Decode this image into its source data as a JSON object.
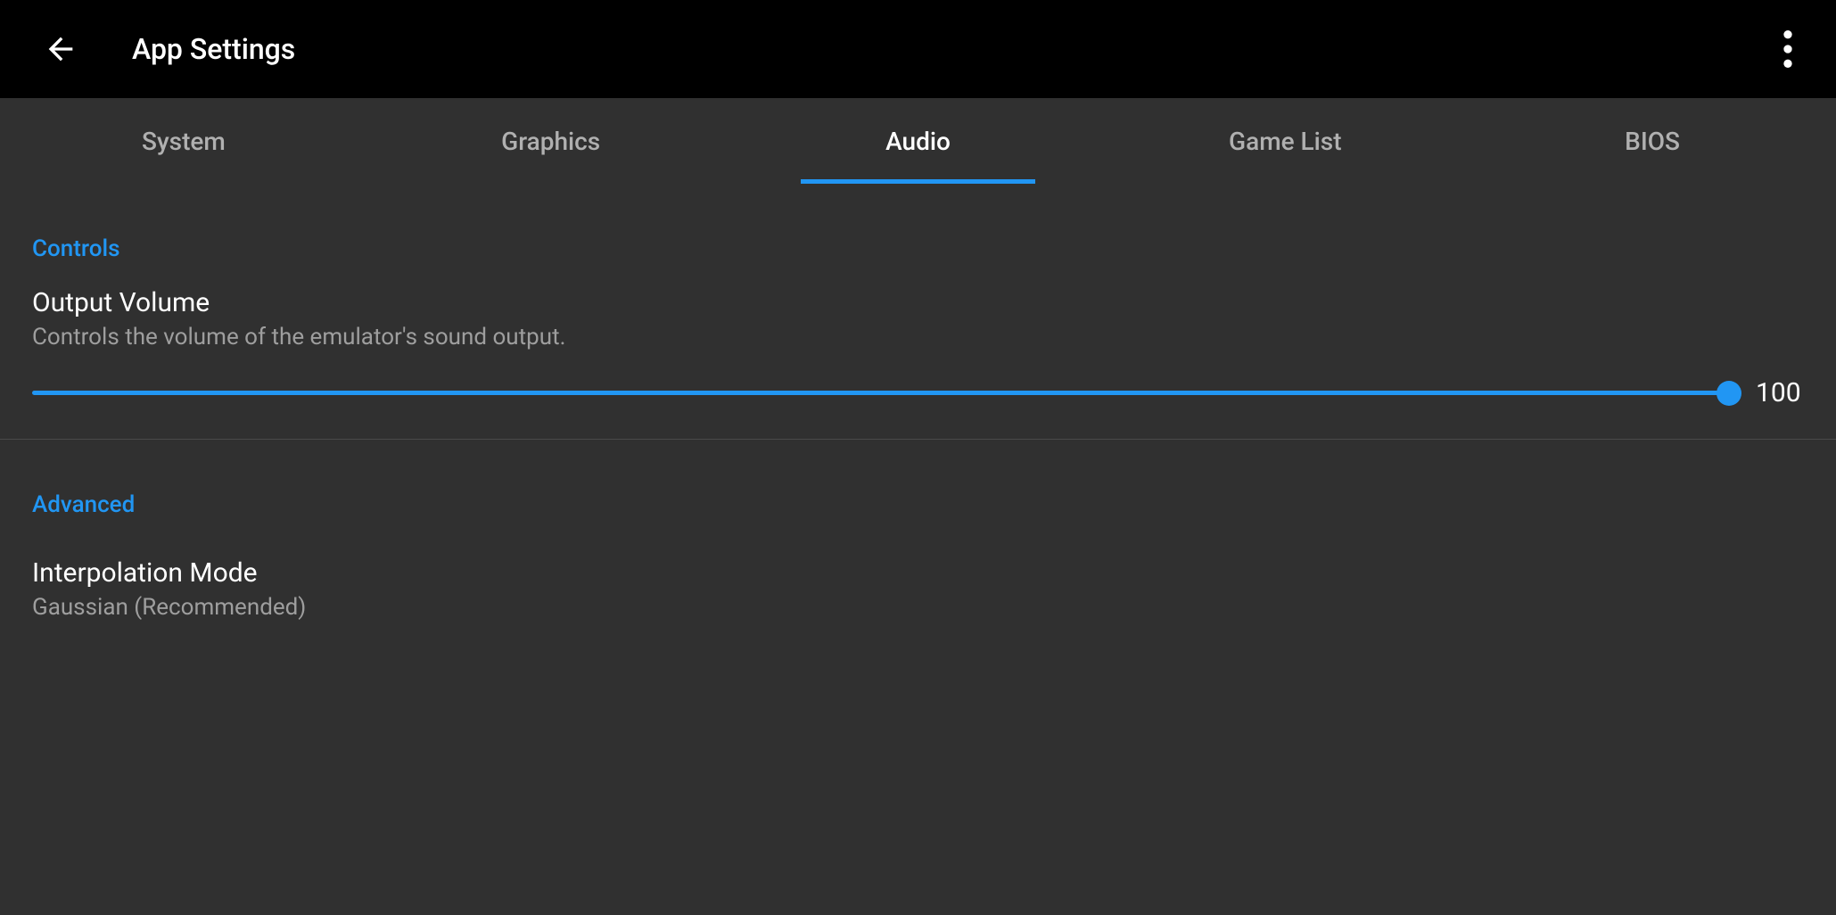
{
  "header": {
    "title": "App Settings"
  },
  "tabs": [
    {
      "label": "System",
      "active": false
    },
    {
      "label": "Graphics",
      "active": false
    },
    {
      "label": "Audio",
      "active": true
    },
    {
      "label": "Game List",
      "active": false
    },
    {
      "label": "BIOS",
      "active": false
    }
  ],
  "sections": {
    "controls": {
      "header": "Controls",
      "output_volume": {
        "title": "Output Volume",
        "description": "Controls the volume of the emulator's sound output.",
        "value": "100"
      }
    },
    "advanced": {
      "header": "Advanced",
      "interpolation": {
        "title": "Interpolation Mode",
        "value": "Gaussian (Recommended)"
      }
    }
  }
}
